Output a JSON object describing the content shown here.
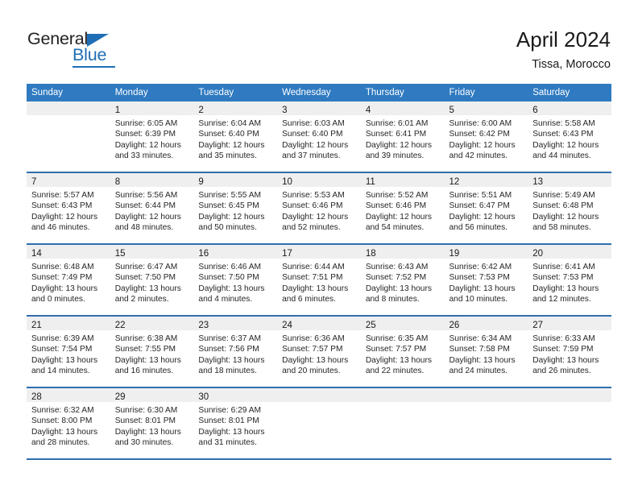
{
  "logo": {
    "word_one": "General",
    "word_two": "Blue",
    "triangle_icon": "blue-triangle-icon",
    "accent_color": "#1f6eb5"
  },
  "header": {
    "title": "April 2024",
    "subtitle": "Tissa, Morocco"
  },
  "theme": {
    "header_bg": "#2f7ac0",
    "row_divider": "#2f6fad",
    "daynum_band": "#efefef",
    "text": "#262626"
  },
  "calendar": {
    "weekday_headers": [
      "Sunday",
      "Monday",
      "Tuesday",
      "Wednesday",
      "Thursday",
      "Friday",
      "Saturday"
    ],
    "weeks": [
      [
        {
          "day": "",
          "empty": true,
          "sunrise": "",
          "sunset": "",
          "daylight_line1": "",
          "daylight_line2": ""
        },
        {
          "day": "1",
          "empty": false,
          "sunrise": "Sunrise: 6:05 AM",
          "sunset": "Sunset: 6:39 PM",
          "daylight_line1": "Daylight: 12 hours",
          "daylight_line2": "and 33 minutes."
        },
        {
          "day": "2",
          "empty": false,
          "sunrise": "Sunrise: 6:04 AM",
          "sunset": "Sunset: 6:40 PM",
          "daylight_line1": "Daylight: 12 hours",
          "daylight_line2": "and 35 minutes."
        },
        {
          "day": "3",
          "empty": false,
          "sunrise": "Sunrise: 6:03 AM",
          "sunset": "Sunset: 6:40 PM",
          "daylight_line1": "Daylight: 12 hours",
          "daylight_line2": "and 37 minutes."
        },
        {
          "day": "4",
          "empty": false,
          "sunrise": "Sunrise: 6:01 AM",
          "sunset": "Sunset: 6:41 PM",
          "daylight_line1": "Daylight: 12 hours",
          "daylight_line2": "and 39 minutes."
        },
        {
          "day": "5",
          "empty": false,
          "sunrise": "Sunrise: 6:00 AM",
          "sunset": "Sunset: 6:42 PM",
          "daylight_line1": "Daylight: 12 hours",
          "daylight_line2": "and 42 minutes."
        },
        {
          "day": "6",
          "empty": false,
          "sunrise": "Sunrise: 5:58 AM",
          "sunset": "Sunset: 6:43 PM",
          "daylight_line1": "Daylight: 12 hours",
          "daylight_line2": "and 44 minutes."
        }
      ],
      [
        {
          "day": "7",
          "empty": false,
          "sunrise": "Sunrise: 5:57 AM",
          "sunset": "Sunset: 6:43 PM",
          "daylight_line1": "Daylight: 12 hours",
          "daylight_line2": "and 46 minutes."
        },
        {
          "day": "8",
          "empty": false,
          "sunrise": "Sunrise: 5:56 AM",
          "sunset": "Sunset: 6:44 PM",
          "daylight_line1": "Daylight: 12 hours",
          "daylight_line2": "and 48 minutes."
        },
        {
          "day": "9",
          "empty": false,
          "sunrise": "Sunrise: 5:55 AM",
          "sunset": "Sunset: 6:45 PM",
          "daylight_line1": "Daylight: 12 hours",
          "daylight_line2": "and 50 minutes."
        },
        {
          "day": "10",
          "empty": false,
          "sunrise": "Sunrise: 5:53 AM",
          "sunset": "Sunset: 6:46 PM",
          "daylight_line1": "Daylight: 12 hours",
          "daylight_line2": "and 52 minutes."
        },
        {
          "day": "11",
          "empty": false,
          "sunrise": "Sunrise: 5:52 AM",
          "sunset": "Sunset: 6:46 PM",
          "daylight_line1": "Daylight: 12 hours",
          "daylight_line2": "and 54 minutes."
        },
        {
          "day": "12",
          "empty": false,
          "sunrise": "Sunrise: 5:51 AM",
          "sunset": "Sunset: 6:47 PM",
          "daylight_line1": "Daylight: 12 hours",
          "daylight_line2": "and 56 minutes."
        },
        {
          "day": "13",
          "empty": false,
          "sunrise": "Sunrise: 5:49 AM",
          "sunset": "Sunset: 6:48 PM",
          "daylight_line1": "Daylight: 12 hours",
          "daylight_line2": "and 58 minutes."
        }
      ],
      [
        {
          "day": "14",
          "empty": false,
          "sunrise": "Sunrise: 6:48 AM",
          "sunset": "Sunset: 7:49 PM",
          "daylight_line1": "Daylight: 13 hours",
          "daylight_line2": "and 0 minutes."
        },
        {
          "day": "15",
          "empty": false,
          "sunrise": "Sunrise: 6:47 AM",
          "sunset": "Sunset: 7:50 PM",
          "daylight_line1": "Daylight: 13 hours",
          "daylight_line2": "and 2 minutes."
        },
        {
          "day": "16",
          "empty": false,
          "sunrise": "Sunrise: 6:46 AM",
          "sunset": "Sunset: 7:50 PM",
          "daylight_line1": "Daylight: 13 hours",
          "daylight_line2": "and 4 minutes."
        },
        {
          "day": "17",
          "empty": false,
          "sunrise": "Sunrise: 6:44 AM",
          "sunset": "Sunset: 7:51 PM",
          "daylight_line1": "Daylight: 13 hours",
          "daylight_line2": "and 6 minutes."
        },
        {
          "day": "18",
          "empty": false,
          "sunrise": "Sunrise: 6:43 AM",
          "sunset": "Sunset: 7:52 PM",
          "daylight_line1": "Daylight: 13 hours",
          "daylight_line2": "and 8 minutes."
        },
        {
          "day": "19",
          "empty": false,
          "sunrise": "Sunrise: 6:42 AM",
          "sunset": "Sunset: 7:53 PM",
          "daylight_line1": "Daylight: 13 hours",
          "daylight_line2": "and 10 minutes."
        },
        {
          "day": "20",
          "empty": false,
          "sunrise": "Sunrise: 6:41 AM",
          "sunset": "Sunset: 7:53 PM",
          "daylight_line1": "Daylight: 13 hours",
          "daylight_line2": "and 12 minutes."
        }
      ],
      [
        {
          "day": "21",
          "empty": false,
          "sunrise": "Sunrise: 6:39 AM",
          "sunset": "Sunset: 7:54 PM",
          "daylight_line1": "Daylight: 13 hours",
          "daylight_line2": "and 14 minutes."
        },
        {
          "day": "22",
          "empty": false,
          "sunrise": "Sunrise: 6:38 AM",
          "sunset": "Sunset: 7:55 PM",
          "daylight_line1": "Daylight: 13 hours",
          "daylight_line2": "and 16 minutes."
        },
        {
          "day": "23",
          "empty": false,
          "sunrise": "Sunrise: 6:37 AM",
          "sunset": "Sunset: 7:56 PM",
          "daylight_line1": "Daylight: 13 hours",
          "daylight_line2": "and 18 minutes."
        },
        {
          "day": "24",
          "empty": false,
          "sunrise": "Sunrise: 6:36 AM",
          "sunset": "Sunset: 7:57 PM",
          "daylight_line1": "Daylight: 13 hours",
          "daylight_line2": "and 20 minutes."
        },
        {
          "day": "25",
          "empty": false,
          "sunrise": "Sunrise: 6:35 AM",
          "sunset": "Sunset: 7:57 PM",
          "daylight_line1": "Daylight: 13 hours",
          "daylight_line2": "and 22 minutes."
        },
        {
          "day": "26",
          "empty": false,
          "sunrise": "Sunrise: 6:34 AM",
          "sunset": "Sunset: 7:58 PM",
          "daylight_line1": "Daylight: 13 hours",
          "daylight_line2": "and 24 minutes."
        },
        {
          "day": "27",
          "empty": false,
          "sunrise": "Sunrise: 6:33 AM",
          "sunset": "Sunset: 7:59 PM",
          "daylight_line1": "Daylight: 13 hours",
          "daylight_line2": "and 26 minutes."
        }
      ],
      [
        {
          "day": "28",
          "empty": false,
          "sunrise": "Sunrise: 6:32 AM",
          "sunset": "Sunset: 8:00 PM",
          "daylight_line1": "Daylight: 13 hours",
          "daylight_line2": "and 28 minutes."
        },
        {
          "day": "29",
          "empty": false,
          "sunrise": "Sunrise: 6:30 AM",
          "sunset": "Sunset: 8:01 PM",
          "daylight_line1": "Daylight: 13 hours",
          "daylight_line2": "and 30 minutes."
        },
        {
          "day": "30",
          "empty": false,
          "sunrise": "Sunrise: 6:29 AM",
          "sunset": "Sunset: 8:01 PM",
          "daylight_line1": "Daylight: 13 hours",
          "daylight_line2": "and 31 minutes."
        },
        {
          "day": "",
          "empty": true,
          "sunrise": "",
          "sunset": "",
          "daylight_line1": "",
          "daylight_line2": ""
        },
        {
          "day": "",
          "empty": true,
          "sunrise": "",
          "sunset": "",
          "daylight_line1": "",
          "daylight_line2": ""
        },
        {
          "day": "",
          "empty": true,
          "sunrise": "",
          "sunset": "",
          "daylight_line1": "",
          "daylight_line2": ""
        },
        {
          "day": "",
          "empty": true,
          "sunrise": "",
          "sunset": "",
          "daylight_line1": "",
          "daylight_line2": ""
        }
      ]
    ]
  }
}
